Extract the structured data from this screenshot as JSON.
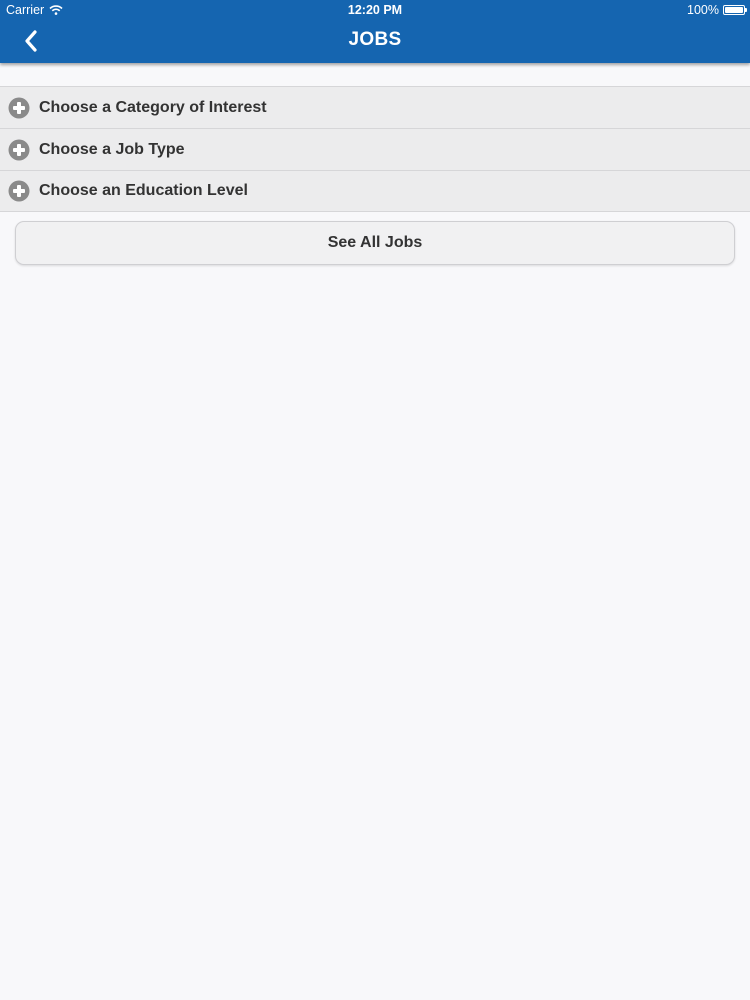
{
  "status_bar": {
    "carrier": "Carrier",
    "time": "12:20 PM",
    "battery_percent": "100%",
    "battery_level": 1.0
  },
  "navbar": {
    "title": "JOBS",
    "back_icon": "chevron-left-icon"
  },
  "filters": [
    {
      "label": "Choose a Category of Interest",
      "icon": "plus-circle-icon"
    },
    {
      "label": "Choose a Job Type",
      "icon": "plus-circle-icon"
    },
    {
      "label": "Choose an Education Level",
      "icon": "plus-circle-icon"
    }
  ],
  "see_all_button": {
    "label": "See All Jobs"
  },
  "colors": {
    "header": "#1565b0",
    "background": "#f8f8fa",
    "row": "#ececed",
    "text": "#333333",
    "icon": "#8a8a8a"
  }
}
